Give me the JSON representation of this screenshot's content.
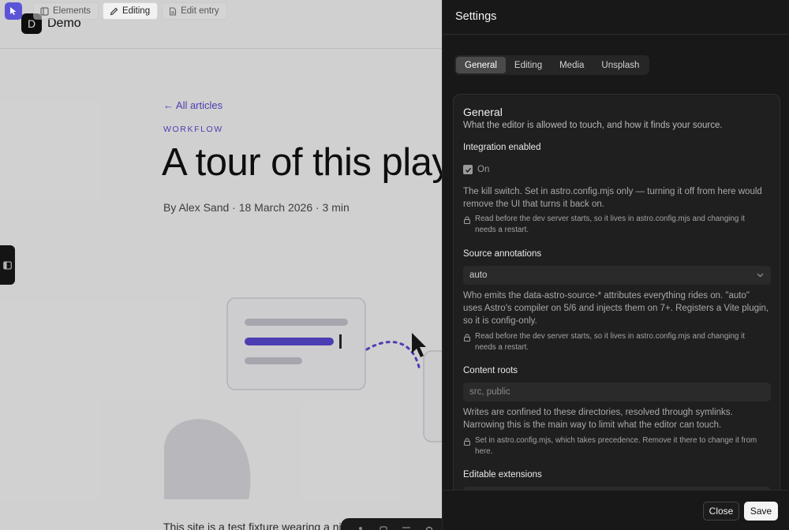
{
  "toolbar": {
    "elements_label": "Elements",
    "editing_label": "Editing",
    "edit_entry_label": "Edit entry"
  },
  "site": {
    "logo_letter": "D",
    "name": "Demo"
  },
  "article": {
    "back_link": "← All articles",
    "kicker": "WORKFLOW",
    "title": "A tour of this play",
    "byline": "By Alex Sand · 18 March 2026 · 3 min",
    "teaser": "This site is a test fixture wearing a nice c"
  },
  "panel": {
    "title": "Settings",
    "tabs": [
      {
        "label": "General",
        "active": true
      },
      {
        "label": "Editing",
        "active": false
      },
      {
        "label": "Media",
        "active": false
      },
      {
        "label": "Unsplash",
        "active": false
      }
    ],
    "section": {
      "title": "General",
      "description": "What the editor is allowed to touch, and how it finds your source."
    },
    "integration": {
      "label": "Integration enabled",
      "checkbox_label": "On",
      "help_line1": "The kill switch. Set in astro.config.mjs only — turning it off from here would",
      "help_line2": "remove the UI that turns it back on.",
      "note_line1": "Read before the dev server starts, so it lives in astro.config.mjs and changing it",
      "note_line2": "needs a restart."
    },
    "annotations": {
      "label": "Source annotations",
      "value": "auto",
      "help_line1": "Who emits the data-astro-source-* attributes everything rides on. \"auto\"",
      "help_line2": "uses Astro's compiler on 5/6 and injects them on 7+. Registers a Vite plugin,",
      "help_line3": "so it is config-only.",
      "note_line1": "Read before the dev server starts, so it lives in astro.config.mjs and changing it",
      "note_line2": "needs a restart."
    },
    "roots": {
      "label": "Content roots",
      "placeholder": "src, public",
      "help_line1": "Writes are confined to these directories, resolved through symlinks.",
      "help_line2": "Narrowing this is the main way to limit what the editor can touch.",
      "note_line1": "Set in astro.config.mjs, which takes precedence. Remove it there to change it from",
      "note_line2": "here."
    },
    "extensions": {
      "label": "Editable extensions"
    },
    "footer": {
      "close_label": "Close",
      "save_label": "Save"
    }
  },
  "colors": {
    "accent": "#5b4bd6",
    "panel_bg": "#181818",
    "card_bg": "#1f1f1f"
  }
}
